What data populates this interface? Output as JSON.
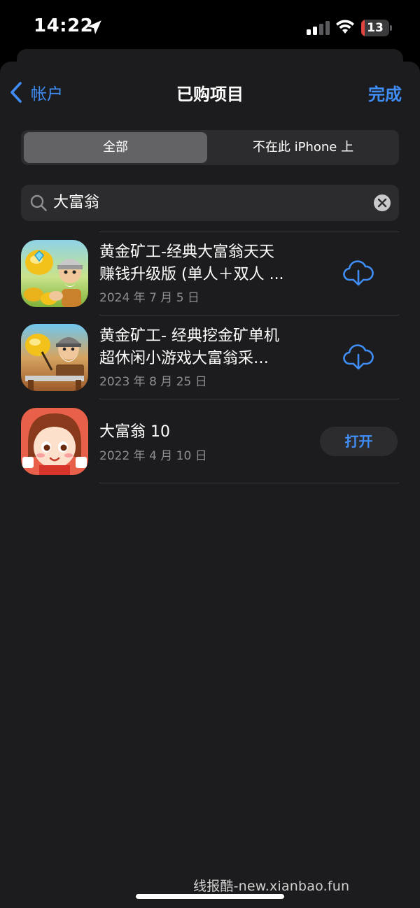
{
  "status": {
    "time": "14:22",
    "battery": "13",
    "battery_level": 0.13
  },
  "nav": {
    "back_label": "帐户",
    "title": "已购项目",
    "done_label": "完成"
  },
  "segments": {
    "all": "全部",
    "not_on_device": "不在此 iPhone 上"
  },
  "search": {
    "value": "大富翁"
  },
  "apps": [
    {
      "title_line1": "黄金矿工-经典大富翁天天",
      "title_line2": "赚钱升级版 (单人＋双人 ...",
      "date": "2024 年 7 月 5 日",
      "action": "download"
    },
    {
      "title_line1": "黄金矿工- 经典挖金矿单机",
      "title_line2": "超休闲小游戏大富翁采…",
      "date": "2023 年 8 月 25 日",
      "action": "download"
    },
    {
      "title_line1": "大富翁 10",
      "date": "2022 年 4 月 10 日",
      "action_label": "打开"
    }
  ],
  "watermark": "线报酷-new.xianbao.fun",
  "colors": {
    "accent": "#3f8df5",
    "background": "#1c1c1e",
    "battery_low": "#e0443a"
  }
}
